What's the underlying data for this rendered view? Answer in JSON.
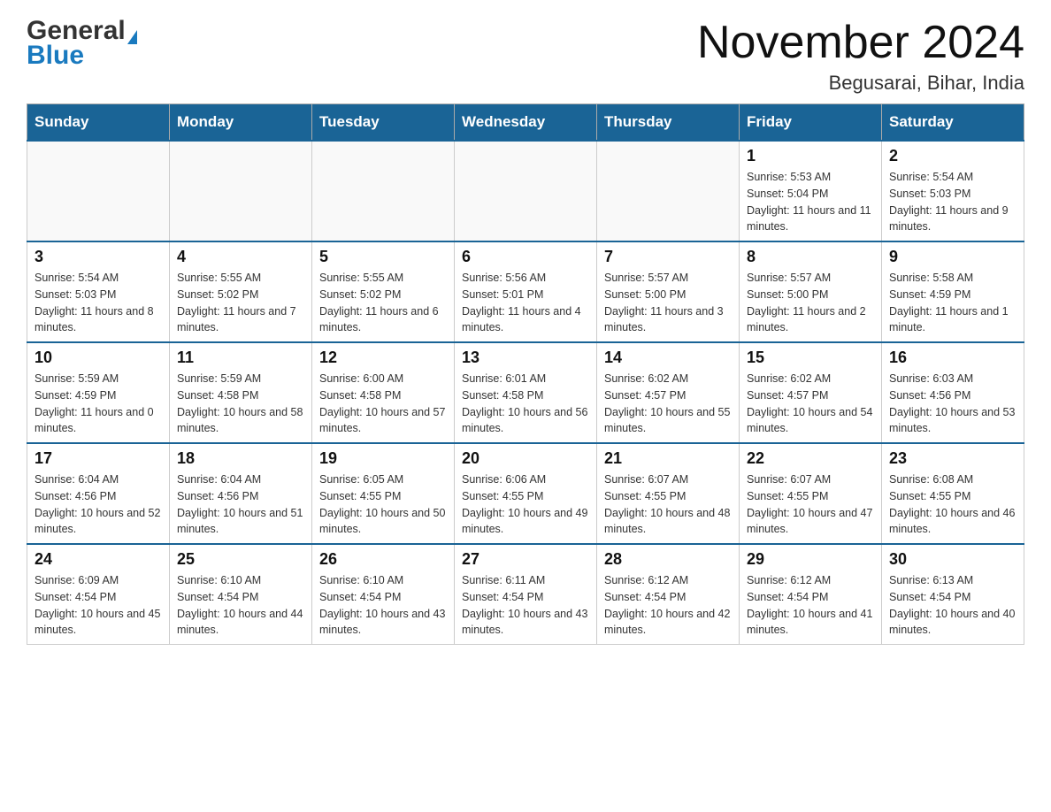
{
  "header": {
    "logo": {
      "general": "General",
      "blue": "Blue",
      "arrow": "▲"
    },
    "title": "November 2024",
    "location": "Begusarai, Bihar, India"
  },
  "calendar": {
    "weekdays": [
      "Sunday",
      "Monday",
      "Tuesday",
      "Wednesday",
      "Thursday",
      "Friday",
      "Saturday"
    ],
    "weeks": [
      {
        "days": [
          {
            "number": "",
            "info": ""
          },
          {
            "number": "",
            "info": ""
          },
          {
            "number": "",
            "info": ""
          },
          {
            "number": "",
            "info": ""
          },
          {
            "number": "",
            "info": ""
          },
          {
            "number": "1",
            "info": "Sunrise: 5:53 AM\nSunset: 5:04 PM\nDaylight: 11 hours and 11 minutes."
          },
          {
            "number": "2",
            "info": "Sunrise: 5:54 AM\nSunset: 5:03 PM\nDaylight: 11 hours and 9 minutes."
          }
        ]
      },
      {
        "days": [
          {
            "number": "3",
            "info": "Sunrise: 5:54 AM\nSunset: 5:03 PM\nDaylight: 11 hours and 8 minutes."
          },
          {
            "number": "4",
            "info": "Sunrise: 5:55 AM\nSunset: 5:02 PM\nDaylight: 11 hours and 7 minutes."
          },
          {
            "number": "5",
            "info": "Sunrise: 5:55 AM\nSunset: 5:02 PM\nDaylight: 11 hours and 6 minutes."
          },
          {
            "number": "6",
            "info": "Sunrise: 5:56 AM\nSunset: 5:01 PM\nDaylight: 11 hours and 4 minutes."
          },
          {
            "number": "7",
            "info": "Sunrise: 5:57 AM\nSunset: 5:00 PM\nDaylight: 11 hours and 3 minutes."
          },
          {
            "number": "8",
            "info": "Sunrise: 5:57 AM\nSunset: 5:00 PM\nDaylight: 11 hours and 2 minutes."
          },
          {
            "number": "9",
            "info": "Sunrise: 5:58 AM\nSunset: 4:59 PM\nDaylight: 11 hours and 1 minute."
          }
        ]
      },
      {
        "days": [
          {
            "number": "10",
            "info": "Sunrise: 5:59 AM\nSunset: 4:59 PM\nDaylight: 11 hours and 0 minutes."
          },
          {
            "number": "11",
            "info": "Sunrise: 5:59 AM\nSunset: 4:58 PM\nDaylight: 10 hours and 58 minutes."
          },
          {
            "number": "12",
            "info": "Sunrise: 6:00 AM\nSunset: 4:58 PM\nDaylight: 10 hours and 57 minutes."
          },
          {
            "number": "13",
            "info": "Sunrise: 6:01 AM\nSunset: 4:58 PM\nDaylight: 10 hours and 56 minutes."
          },
          {
            "number": "14",
            "info": "Sunrise: 6:02 AM\nSunset: 4:57 PM\nDaylight: 10 hours and 55 minutes."
          },
          {
            "number": "15",
            "info": "Sunrise: 6:02 AM\nSunset: 4:57 PM\nDaylight: 10 hours and 54 minutes."
          },
          {
            "number": "16",
            "info": "Sunrise: 6:03 AM\nSunset: 4:56 PM\nDaylight: 10 hours and 53 minutes."
          }
        ]
      },
      {
        "days": [
          {
            "number": "17",
            "info": "Sunrise: 6:04 AM\nSunset: 4:56 PM\nDaylight: 10 hours and 52 minutes."
          },
          {
            "number": "18",
            "info": "Sunrise: 6:04 AM\nSunset: 4:56 PM\nDaylight: 10 hours and 51 minutes."
          },
          {
            "number": "19",
            "info": "Sunrise: 6:05 AM\nSunset: 4:55 PM\nDaylight: 10 hours and 50 minutes."
          },
          {
            "number": "20",
            "info": "Sunrise: 6:06 AM\nSunset: 4:55 PM\nDaylight: 10 hours and 49 minutes."
          },
          {
            "number": "21",
            "info": "Sunrise: 6:07 AM\nSunset: 4:55 PM\nDaylight: 10 hours and 48 minutes."
          },
          {
            "number": "22",
            "info": "Sunrise: 6:07 AM\nSunset: 4:55 PM\nDaylight: 10 hours and 47 minutes."
          },
          {
            "number": "23",
            "info": "Sunrise: 6:08 AM\nSunset: 4:55 PM\nDaylight: 10 hours and 46 minutes."
          }
        ]
      },
      {
        "days": [
          {
            "number": "24",
            "info": "Sunrise: 6:09 AM\nSunset: 4:54 PM\nDaylight: 10 hours and 45 minutes."
          },
          {
            "number": "25",
            "info": "Sunrise: 6:10 AM\nSunset: 4:54 PM\nDaylight: 10 hours and 44 minutes."
          },
          {
            "number": "26",
            "info": "Sunrise: 6:10 AM\nSunset: 4:54 PM\nDaylight: 10 hours and 43 minutes."
          },
          {
            "number": "27",
            "info": "Sunrise: 6:11 AM\nSunset: 4:54 PM\nDaylight: 10 hours and 43 minutes."
          },
          {
            "number": "28",
            "info": "Sunrise: 6:12 AM\nSunset: 4:54 PM\nDaylight: 10 hours and 42 minutes."
          },
          {
            "number": "29",
            "info": "Sunrise: 6:12 AM\nSunset: 4:54 PM\nDaylight: 10 hours and 41 minutes."
          },
          {
            "number": "30",
            "info": "Sunrise: 6:13 AM\nSunset: 4:54 PM\nDaylight: 10 hours and 40 minutes."
          }
        ]
      }
    ]
  }
}
